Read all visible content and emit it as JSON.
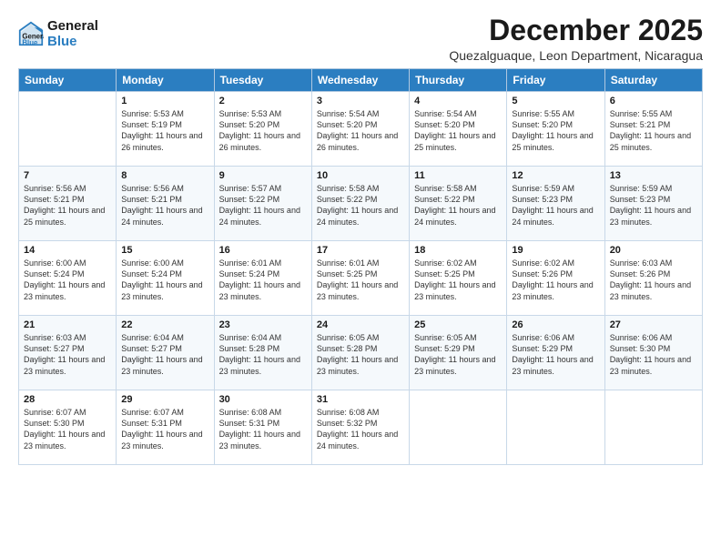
{
  "logo": {
    "line1": "General",
    "line2": "Blue"
  },
  "title": "December 2025",
  "subtitle": "Quezalguaque, Leon Department, Nicaragua",
  "days": [
    "Sunday",
    "Monday",
    "Tuesday",
    "Wednesday",
    "Thursday",
    "Friday",
    "Saturday"
  ],
  "weeks": [
    [
      {
        "num": "",
        "sunrise": "",
        "sunset": "",
        "daylight": ""
      },
      {
        "num": "1",
        "sunrise": "Sunrise: 5:53 AM",
        "sunset": "Sunset: 5:19 PM",
        "daylight": "Daylight: 11 hours and 26 minutes."
      },
      {
        "num": "2",
        "sunrise": "Sunrise: 5:53 AM",
        "sunset": "Sunset: 5:20 PM",
        "daylight": "Daylight: 11 hours and 26 minutes."
      },
      {
        "num": "3",
        "sunrise": "Sunrise: 5:54 AM",
        "sunset": "Sunset: 5:20 PM",
        "daylight": "Daylight: 11 hours and 26 minutes."
      },
      {
        "num": "4",
        "sunrise": "Sunrise: 5:54 AM",
        "sunset": "Sunset: 5:20 PM",
        "daylight": "Daylight: 11 hours and 25 minutes."
      },
      {
        "num": "5",
        "sunrise": "Sunrise: 5:55 AM",
        "sunset": "Sunset: 5:20 PM",
        "daylight": "Daylight: 11 hours and 25 minutes."
      },
      {
        "num": "6",
        "sunrise": "Sunrise: 5:55 AM",
        "sunset": "Sunset: 5:21 PM",
        "daylight": "Daylight: 11 hours and 25 minutes."
      }
    ],
    [
      {
        "num": "7",
        "sunrise": "Sunrise: 5:56 AM",
        "sunset": "Sunset: 5:21 PM",
        "daylight": "Daylight: 11 hours and 25 minutes."
      },
      {
        "num": "8",
        "sunrise": "Sunrise: 5:56 AM",
        "sunset": "Sunset: 5:21 PM",
        "daylight": "Daylight: 11 hours and 24 minutes."
      },
      {
        "num": "9",
        "sunrise": "Sunrise: 5:57 AM",
        "sunset": "Sunset: 5:22 PM",
        "daylight": "Daylight: 11 hours and 24 minutes."
      },
      {
        "num": "10",
        "sunrise": "Sunrise: 5:58 AM",
        "sunset": "Sunset: 5:22 PM",
        "daylight": "Daylight: 11 hours and 24 minutes."
      },
      {
        "num": "11",
        "sunrise": "Sunrise: 5:58 AM",
        "sunset": "Sunset: 5:22 PM",
        "daylight": "Daylight: 11 hours and 24 minutes."
      },
      {
        "num": "12",
        "sunrise": "Sunrise: 5:59 AM",
        "sunset": "Sunset: 5:23 PM",
        "daylight": "Daylight: 11 hours and 24 minutes."
      },
      {
        "num": "13",
        "sunrise": "Sunrise: 5:59 AM",
        "sunset": "Sunset: 5:23 PM",
        "daylight": "Daylight: 11 hours and 23 minutes."
      }
    ],
    [
      {
        "num": "14",
        "sunrise": "Sunrise: 6:00 AM",
        "sunset": "Sunset: 5:24 PM",
        "daylight": "Daylight: 11 hours and 23 minutes."
      },
      {
        "num": "15",
        "sunrise": "Sunrise: 6:00 AM",
        "sunset": "Sunset: 5:24 PM",
        "daylight": "Daylight: 11 hours and 23 minutes."
      },
      {
        "num": "16",
        "sunrise": "Sunrise: 6:01 AM",
        "sunset": "Sunset: 5:24 PM",
        "daylight": "Daylight: 11 hours and 23 minutes."
      },
      {
        "num": "17",
        "sunrise": "Sunrise: 6:01 AM",
        "sunset": "Sunset: 5:25 PM",
        "daylight": "Daylight: 11 hours and 23 minutes."
      },
      {
        "num": "18",
        "sunrise": "Sunrise: 6:02 AM",
        "sunset": "Sunset: 5:25 PM",
        "daylight": "Daylight: 11 hours and 23 minutes."
      },
      {
        "num": "19",
        "sunrise": "Sunrise: 6:02 AM",
        "sunset": "Sunset: 5:26 PM",
        "daylight": "Daylight: 11 hours and 23 minutes."
      },
      {
        "num": "20",
        "sunrise": "Sunrise: 6:03 AM",
        "sunset": "Sunset: 5:26 PM",
        "daylight": "Daylight: 11 hours and 23 minutes."
      }
    ],
    [
      {
        "num": "21",
        "sunrise": "Sunrise: 6:03 AM",
        "sunset": "Sunset: 5:27 PM",
        "daylight": "Daylight: 11 hours and 23 minutes."
      },
      {
        "num": "22",
        "sunrise": "Sunrise: 6:04 AM",
        "sunset": "Sunset: 5:27 PM",
        "daylight": "Daylight: 11 hours and 23 minutes."
      },
      {
        "num": "23",
        "sunrise": "Sunrise: 6:04 AM",
        "sunset": "Sunset: 5:28 PM",
        "daylight": "Daylight: 11 hours and 23 minutes."
      },
      {
        "num": "24",
        "sunrise": "Sunrise: 6:05 AM",
        "sunset": "Sunset: 5:28 PM",
        "daylight": "Daylight: 11 hours and 23 minutes."
      },
      {
        "num": "25",
        "sunrise": "Sunrise: 6:05 AM",
        "sunset": "Sunset: 5:29 PM",
        "daylight": "Daylight: 11 hours and 23 minutes."
      },
      {
        "num": "26",
        "sunrise": "Sunrise: 6:06 AM",
        "sunset": "Sunset: 5:29 PM",
        "daylight": "Daylight: 11 hours and 23 minutes."
      },
      {
        "num": "27",
        "sunrise": "Sunrise: 6:06 AM",
        "sunset": "Sunset: 5:30 PM",
        "daylight": "Daylight: 11 hours and 23 minutes."
      }
    ],
    [
      {
        "num": "28",
        "sunrise": "Sunrise: 6:07 AM",
        "sunset": "Sunset: 5:30 PM",
        "daylight": "Daylight: 11 hours and 23 minutes."
      },
      {
        "num": "29",
        "sunrise": "Sunrise: 6:07 AM",
        "sunset": "Sunset: 5:31 PM",
        "daylight": "Daylight: 11 hours and 23 minutes."
      },
      {
        "num": "30",
        "sunrise": "Sunrise: 6:08 AM",
        "sunset": "Sunset: 5:31 PM",
        "daylight": "Daylight: 11 hours and 23 minutes."
      },
      {
        "num": "31",
        "sunrise": "Sunrise: 6:08 AM",
        "sunset": "Sunset: 5:32 PM",
        "daylight": "Daylight: 11 hours and 24 minutes."
      },
      {
        "num": "",
        "sunrise": "",
        "sunset": "",
        "daylight": ""
      },
      {
        "num": "",
        "sunrise": "",
        "sunset": "",
        "daylight": ""
      },
      {
        "num": "",
        "sunrise": "",
        "sunset": "",
        "daylight": ""
      }
    ]
  ]
}
